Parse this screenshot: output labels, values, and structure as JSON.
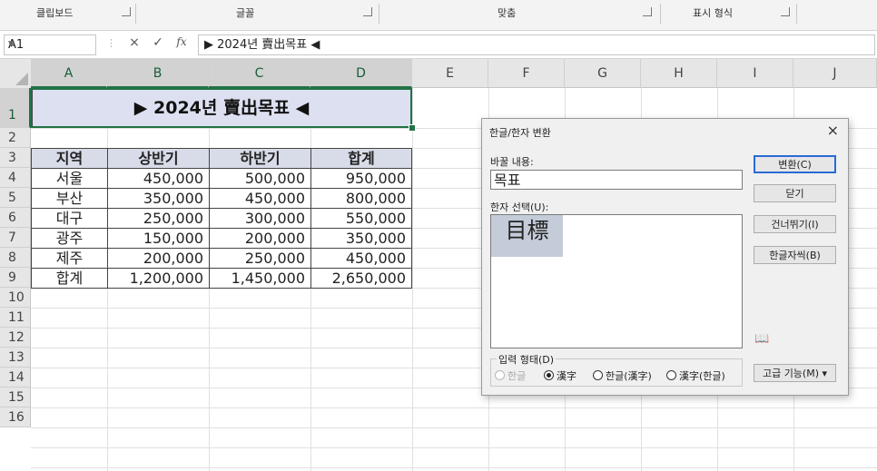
{
  "ribbon": {
    "groups": [
      "클립보드",
      "글꼴",
      "맞춤",
      "표시 형식"
    ]
  },
  "formula_bar": {
    "name_box": "A1",
    "cancel_icon": "×",
    "enter_icon": "✓",
    "fx_label": "fx",
    "content": "▶ 2024년 賣出목표 ◀"
  },
  "columns": [
    "A",
    "B",
    "C",
    "D",
    "E",
    "F",
    "G",
    "H",
    "I",
    "J"
  ],
  "rows": [
    "1",
    "2",
    "3",
    "4",
    "5",
    "6",
    "7",
    "8",
    "9",
    "10",
    "11",
    "12",
    "13",
    "14",
    "15",
    "16"
  ],
  "sheet": {
    "title": "▶ 2024년 賣出목표 ◀",
    "headers": [
      "지역",
      "상반기",
      "하반기",
      "합계"
    ],
    "data": [
      [
        "서울",
        "450,000",
        "500,000",
        "950,000"
      ],
      [
        "부산",
        "350,000",
        "450,000",
        "800,000"
      ],
      [
        "대구",
        "250,000",
        "300,000",
        "550,000"
      ],
      [
        "광주",
        "150,000",
        "200,000",
        "350,000"
      ],
      [
        "제주",
        "200,000",
        "250,000",
        "450,000"
      ],
      [
        "합계",
        "1,200,000",
        "1,450,000",
        "2,650,000"
      ]
    ]
  },
  "dialog": {
    "title": "한글/한자 변환",
    "close": "×",
    "replace_label": "바꿀 내용:",
    "replace_value": "목표",
    "hanja_label": "한자 선택(U):",
    "hanja_items": [
      "目標"
    ],
    "buttons": [
      "변환(C)",
      "닫기",
      "건너뛰기(I)",
      "한글자씩(B)",
      "고급 기능(M) ▾"
    ],
    "dictionary_icon": "📖",
    "input_form_label": "입력 형태(D)",
    "radio_options": [
      {
        "label": "한글",
        "checked": false,
        "disabled": true
      },
      {
        "label": "漢字",
        "checked": true,
        "disabled": false
      },
      {
        "label": "한글(漢字)",
        "checked": false,
        "disabled": false
      },
      {
        "label": "漢字(한글)",
        "checked": false,
        "disabled": false
      }
    ]
  },
  "colors": {
    "excel_green": "#217346",
    "title_fill": "#dde0f1",
    "header_fill": "#d8dce8",
    "hanja_highlight": "#c3ccd8"
  }
}
